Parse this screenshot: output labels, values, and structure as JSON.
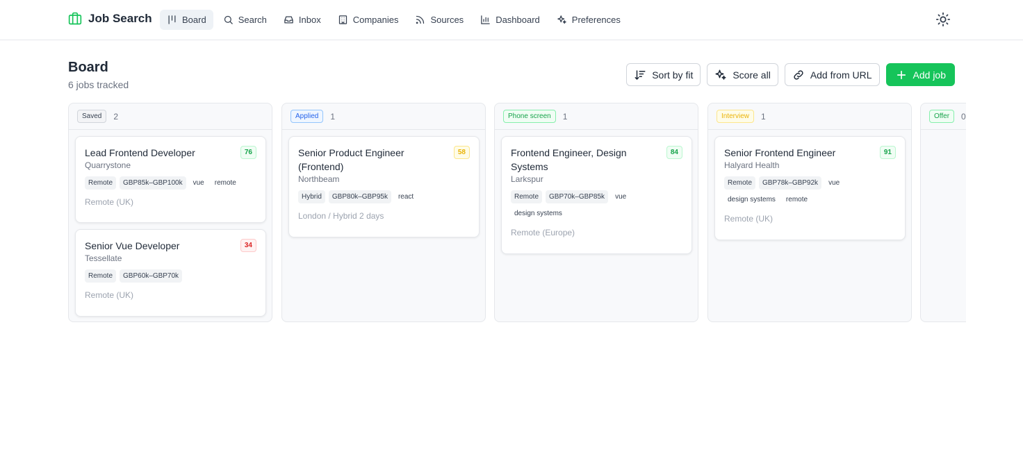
{
  "app": {
    "title": "Job Search"
  },
  "nav": [
    {
      "label": "Board",
      "icon": "board-icon",
      "active": true
    },
    {
      "label": "Search",
      "icon": "search-icon"
    },
    {
      "label": "Inbox",
      "icon": "inbox-icon"
    },
    {
      "label": "Companies",
      "icon": "building-icon"
    },
    {
      "label": "Sources",
      "icon": "rss-icon"
    },
    {
      "label": "Dashboard",
      "icon": "chart-icon"
    },
    {
      "label": "Preferences",
      "icon": "sparkles-icon"
    }
  ],
  "header": {
    "title": "Board",
    "subtitle": "6 jobs tracked"
  },
  "actions": {
    "sort": "Sort by fit",
    "score": "Score all",
    "add_url": "Add from URL",
    "add_job": "Add job"
  },
  "colors": {
    "accent": "#16c45a",
    "score_high": "#16a34a",
    "score_mid": "#eab308",
    "score_low": "#dc2626"
  },
  "columns": [
    {
      "stage": "Saved",
      "count": "2",
      "cards": [
        {
          "title": "Lead Frontend Developer",
          "company": "Quarrystone",
          "score": "76",
          "tags": [
            "Remote",
            "GBP85k–GBP100k",
            "vue",
            "remote"
          ],
          "location": "Remote (UK)"
        },
        {
          "title": "Senior Vue Developer",
          "company": "Tessellate",
          "score": "34",
          "tags": [
            "Remote",
            "GBP60k–GBP70k"
          ],
          "location": "Remote (UK)"
        }
      ]
    },
    {
      "stage": "Applied",
      "count": "1",
      "cards": [
        {
          "title": "Senior Product Engineer (Frontend)",
          "company": "Northbeam",
          "score": "58",
          "tags": [
            "Hybrid",
            "GBP80k–GBP95k",
            "react"
          ],
          "location": "London / Hybrid 2 days"
        }
      ]
    },
    {
      "stage": "Phone screen",
      "count": "1",
      "cards": [
        {
          "title": "Frontend Engineer, Design Systems",
          "company": "Larkspur",
          "score": "84",
          "tags": [
            "Remote",
            "GBP70k–GBP85k",
            "vue",
            "design systems"
          ],
          "location": "Remote (Europe)"
        }
      ]
    },
    {
      "stage": "Interview",
      "count": "1",
      "cards": [
        {
          "title": "Senior Frontend Engineer",
          "company": "Halyard Health",
          "score": "91",
          "tags": [
            "Remote",
            "GBP78k–GBP92k",
            "vue",
            "design systems",
            "remote"
          ],
          "location": "Remote (UK)"
        }
      ]
    },
    {
      "stage": "Offer",
      "count": "0",
      "cards": []
    }
  ]
}
